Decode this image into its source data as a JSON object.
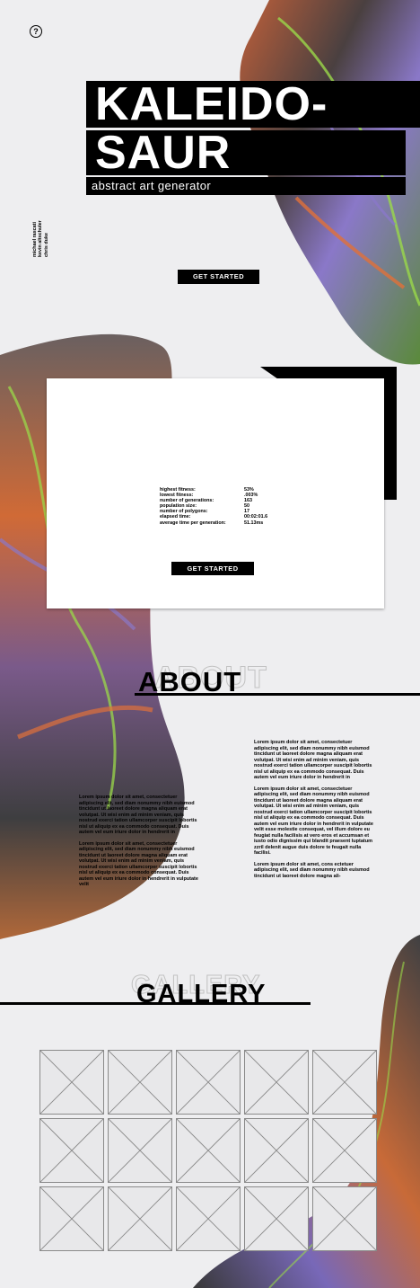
{
  "header": {
    "help_icon": "question-circle-icon",
    "title_line1": "KALEIDO-",
    "title_line2": "SAUR",
    "subtitle": "abstract art generator",
    "credits": [
      "michael rascati",
      "kevin altschuler",
      "chris duke"
    ],
    "cta_label": "GET STARTED"
  },
  "generator": {
    "stats": [
      {
        "label": "highest fitness:",
        "value": "53%"
      },
      {
        "label": "lowest fitness:",
        "value": ".003%"
      },
      {
        "label": "number of generations:",
        "value": "163"
      },
      {
        "label": "population size:",
        "value": "50"
      },
      {
        "label": "number of polygons:",
        "value": "17"
      },
      {
        "label": "elapsed time:",
        "value": "00:02:01.6"
      },
      {
        "label": "average time per generation:",
        "value": "51.13ms"
      }
    ],
    "cta_label": "GET STARTED"
  },
  "about": {
    "heading": "ABOUT",
    "left_paragraphs": [
      "Lorem ipsum dolor sit amet, consectetuer adipiscing elit, sed diam nonummy nibh euismod tincidunt ut laoreet dolore magna aliquam erat volutpat. Ut wisi enim ad minim veniam, quis nostrud exerci tation ullamcorper suscipit lobortis nisl ut aliquip ex ea commodo consequat. Duis autem vel eum iriure dolor in hendrerit in",
      "Lorem ipsum dolor sit amet, consectetuer adipiscing elit, sed diam nonummy nibh euismod tincidunt ut laoreet dolore magna aliquam erat volutpat. Ut wisi enim ad minim veniam, quis nostrud exerci tation ullamcorper suscipit lobortis nisl ut aliquip ex ea commodo consequat. Duis autem vel eum iriure dolor in hendrerit in vulputate velit"
    ],
    "right_paragraphs": [
      "Lorem ipsum dolor sit amet, consectetuer adipiscing elit, sed diam nonummy nibh euismod tincidunt ut laoreet dolore magna aliquam erat volutpat. Ut wisi enim ad minim veniam, quis nostrud exerci tation ullamcorper suscipit lobortis nisl ut aliquip ex ea commodo consequat. Duis autem vel eum iriure dolor in hendrerit in",
      "Lorem ipsum dolor sit amet, consectetuer adipiscing elit, sed diam nonummy nibh euismod tincidunt ut laoreet dolore magna aliquam erat volutpat. Ut wisi enim ad minim veniam, quis nostrud exerci tation ullamcorper suscipit lobortis nisl ut aliquip ex ea commodo consequat. Duis autem vel eum iriure dolor in hendrerit in vulputate velit esse molestie consequat, vel illum dolore eu feugiat nulla facilisis at vero eros et accumsan et iusto odio dignissim qui blandit praesent luptatum zzril delenit augue duis dolore te feugait nulla facilisi.",
      "Lorem ipsum dolor sit amet, cons ectetuer adipiscing elit, sed diam nonummy nibh euismod tincidunt ut laoreet dolore magna ali-"
    ]
  },
  "gallery": {
    "heading": "GALLERY",
    "tile_count": 15,
    "tile_icon": "image-placeholder-icon"
  },
  "colors": {
    "background": "#eeeef0",
    "art_base": "#3a3a3c",
    "art_orange": "#e0703a",
    "art_green": "#9ad84a",
    "art_purple": "#8a78c8",
    "ink": "#000000"
  }
}
